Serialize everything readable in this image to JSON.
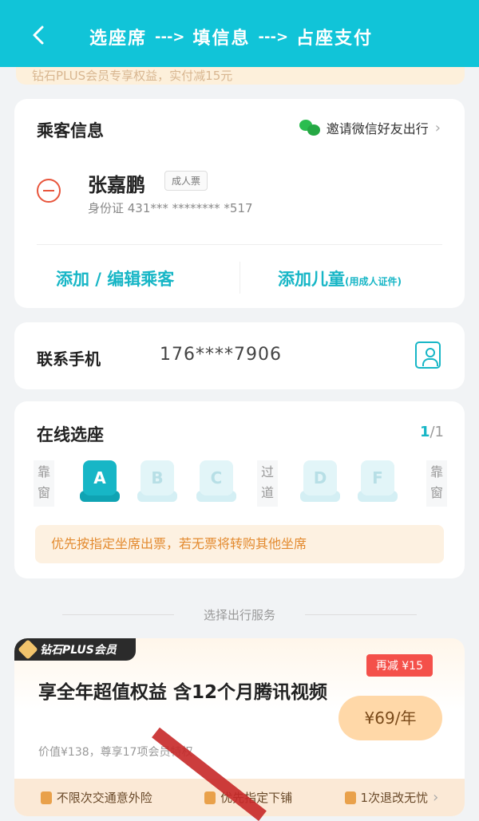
{
  "colors": {
    "accent": "#17b6c6",
    "topbar": "#11c4d8",
    "danger": "#e8553c",
    "warning": "#e38a2f"
  },
  "header": {
    "steps": [
      "选座席",
      "填信息",
      "占座支付"
    ],
    "arrow": "--->",
    "promo_strip": "钻石PLUS会员专享权益，实付减15元"
  },
  "passengers": {
    "title": "乘客信息",
    "invite_label": "邀请微信好友出行",
    "list": [
      {
        "name": "张嘉鹏",
        "badge": "成人票",
        "id": "身份证 431*** ******** *517"
      }
    ],
    "add_edit_label": "添加 / 编辑乘客",
    "add_child_label": "添加儿童",
    "add_child_note": "(用成人证件)"
  },
  "contact": {
    "label": "联系手机",
    "phone": "176****7906"
  },
  "seats": {
    "title": "在线选座",
    "count_selected": "1",
    "count_total": "/1",
    "labels": {
      "window_left": "靠窗",
      "aisle": "过道",
      "window_right": "靠窗"
    },
    "options": [
      "A",
      "B",
      "C",
      "D",
      "F"
    ],
    "selected": "A",
    "notice": "优先按指定坐席出票，若无票将转购其他坐席"
  },
  "service": {
    "section_title": "选择出行服务",
    "badge": "钻石PLUS会员",
    "discount": "再减 ¥15",
    "title": "享全年超值权益 含12个月腾讯视频",
    "price": "¥69/年",
    "subtitle": "价值¥138，尊享17项会员特权",
    "benefits": [
      "不限次交通意外险",
      "优先指定下铺",
      "1次退改无忧"
    ]
  }
}
